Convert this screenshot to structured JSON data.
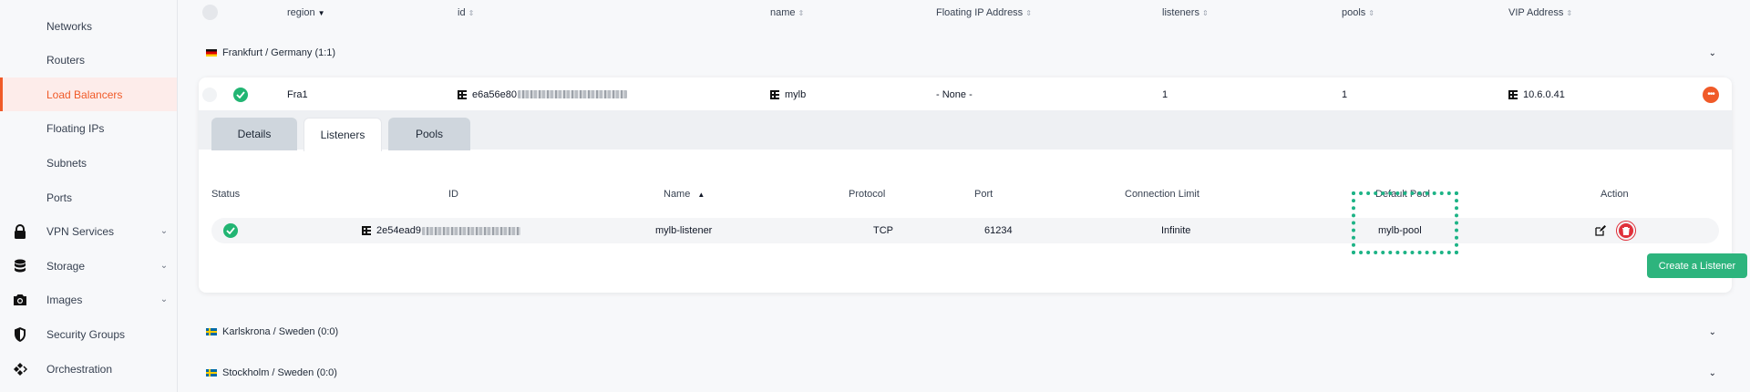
{
  "sidebar": {
    "items": [
      {
        "label": "Networks",
        "icon": "network-icon"
      },
      {
        "label": "Routers",
        "icon": "router-icon"
      },
      {
        "label": "Load Balancers",
        "icon": "load-balancer-icon",
        "active": true
      },
      {
        "label": "Floating IPs",
        "icon": "floating-ip-icon"
      },
      {
        "label": "Subnets",
        "icon": "subnet-icon"
      },
      {
        "label": "Ports",
        "icon": "port-icon"
      },
      {
        "label": "VPN Services",
        "icon": "lock-icon",
        "expandable": true
      },
      {
        "label": "Storage",
        "icon": "database-icon",
        "expandable": true
      },
      {
        "label": "Images",
        "icon": "camera-icon",
        "expandable": true
      },
      {
        "label": "Security Groups",
        "icon": "shield-icon"
      },
      {
        "label": "Orchestration",
        "icon": "orchestration-icon"
      }
    ]
  },
  "table": {
    "headers": {
      "region": "region",
      "id": "id",
      "name": "name",
      "floating_ip": "Floating IP Address",
      "listeners": "listeners",
      "pools": "pools",
      "vip": "VIP Address"
    }
  },
  "groups": [
    {
      "label": "Frankfurt / Germany (1:1)",
      "flag": "de"
    },
    {
      "label": "Karlskrona / Sweden (0:0)",
      "flag": "se"
    },
    {
      "label": "Stockholm / Sweden (0:0)",
      "flag": "se"
    }
  ],
  "load_balancer": {
    "region": "Fra1",
    "id": "e6a56e80",
    "name": "mylb",
    "floating_ip": "- None -",
    "listeners": "1",
    "pools": "1",
    "vip": "10.6.0.41"
  },
  "tabs": [
    {
      "label": "Details"
    },
    {
      "label": "Listeners",
      "active": true
    },
    {
      "label": "Pools"
    }
  ],
  "listeners_table": {
    "headers": {
      "status": "Status",
      "id": "ID",
      "name": "Name",
      "protocol": "Protocol",
      "port": "Port",
      "connection_limit": "Connection Limit",
      "default_pool": "Default Pool",
      "action": "Action"
    },
    "rows": [
      {
        "id": "2e54ead9",
        "name": "mylb-listener",
        "protocol": "TCP",
        "port": "61234",
        "connection_limit": "Infinite",
        "default_pool": "mylb-pool"
      }
    ],
    "create_button": "Create a Listener"
  },
  "colors": {
    "accent": "#f05a28",
    "success": "#22b573",
    "highlight": "#1db386",
    "danger": "#e0303a",
    "button": "#2db47d"
  }
}
